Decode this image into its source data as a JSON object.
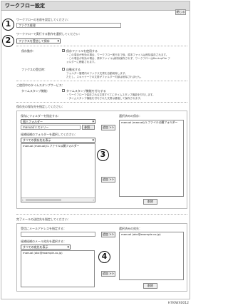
{
  "window": {
    "title": "ワークフロー設定",
    "header_button": "閉じる"
  },
  "section1": {
    "label": "ワークフローの名前を設定してください：",
    "value": "ファクス経理"
  },
  "section2": {
    "label": "ワークフローで実行する動作を選択してください：",
    "selected": "ファクスを受信して保存"
  },
  "options": {
    "save_label": "保存動作：",
    "save_checkbox": "保存ファイルを使用する",
    "save_note1": "・この項目が有効の場合、ワークフロー実行まで後、原本ファイルは削除保存されます。",
    "save_note2": "・この項目が有効の場合、原本ファイルは削除保存されず、ワークフローはBackupFile フ",
    "save_note3": "ォルダーに移動されます。",
    "fax_label": "ファクスの受信時：",
    "fax_checkbox": "自動化する",
    "fax_note1": "フォルダー管理内のファクス文書を自動削除します。",
    "fax_note2": "ただし、スキャナーでの文書がフォルダー内部は削除されません。"
  },
  "timestamp": {
    "heading": "ご使用中のタイムスタンプサービス：",
    "label": "タイムスタンプ機能：",
    "checkbox": "タイムスタンプ機能を付与する",
    "note1": "・ワークフローで保存される文書すべてにタイムスタンプ機能を付与します。",
    "note2": "・タイムスタンプ機能を付与された文書は重複して保存されます。"
  },
  "save_dest": {
    "heading": "保存先の保存先を指定してください：",
    "folder_label": "保存にフォルダーを指定する：",
    "folder_select": "個人フォルダー",
    "folder_path": "manual/ミステリー",
    "browse_button": "参照...",
    "add_button": "追加 >>",
    "candidate_label": "候補候補のフォルダーを選択してください：",
    "candidate_select": "すべての保存先を表示",
    "candidate_items": [
      "manual (manual)/1.ファイル公開フォルダー"
    ],
    "selected_label": "選択済みの保存：",
    "selected_items": [
      "manual (manual)/1.ファイル公開フォルダー"
    ],
    "add_button2": "追加 >>",
    "delete_button": "削除"
  },
  "mail": {
    "heading": "完了メールの送信先を指定してください：",
    "address_label": "受信にメールアドレスを指定する：",
    "add_button": "追加 >>",
    "candidate_label": "候補候補のメール宛先を選択する：",
    "candidate_select": "すべての宛先を表示",
    "candidate_items": [
      "manual (abc@example.co.jp)"
    ],
    "selected_label": "選択済みの宛先：",
    "selected_items": [
      "manual (abc@example.co.jp)"
    ],
    "add_button2": "追加 >>",
    "delete_button": "削除"
  },
  "callouts": [
    "1",
    "2",
    "3",
    "4"
  ],
  "figure_code": "H7I0WX0012"
}
